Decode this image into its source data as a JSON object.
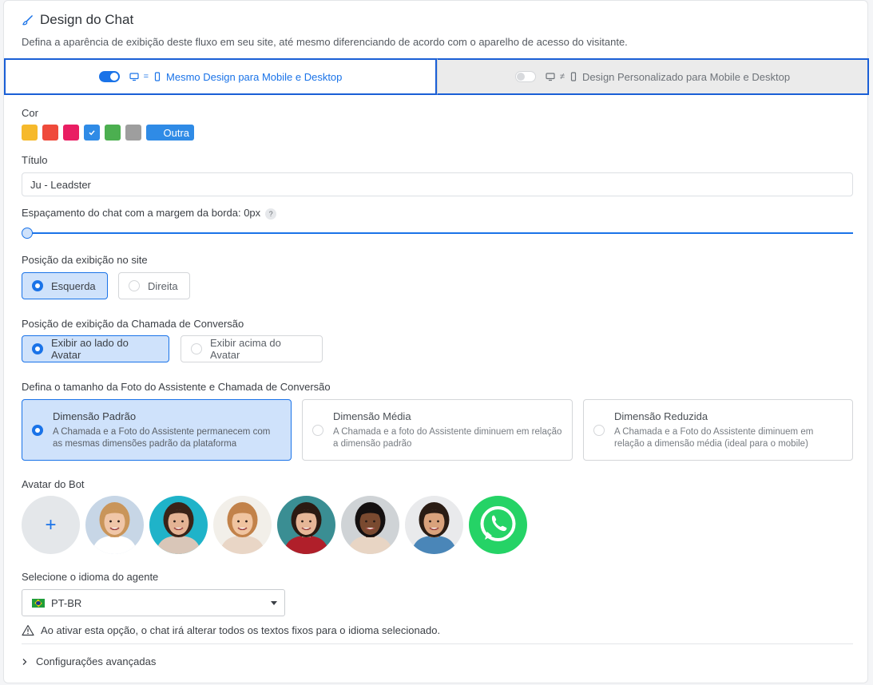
{
  "header": {
    "title": "Design do Chat",
    "subtitle": "Defina a aparência de exibição deste fluxo em seu site, até mesmo diferenciando de acordo com o aparelho de acesso do visitante."
  },
  "tabs": [
    {
      "label": "Mesmo Design para Mobile e Desktop",
      "symbol": "=",
      "active": true
    },
    {
      "label": "Design Personalizado para Mobile e Desktop",
      "symbol": "≠",
      "active": false
    }
  ],
  "color": {
    "label": "Cor",
    "swatches": [
      {
        "hex": "#f6b92b",
        "selected": false
      },
      {
        "hex": "#ef4a3b",
        "selected": false
      },
      {
        "hex": "#e91e63",
        "selected": false
      },
      {
        "hex": "#2f8be6",
        "selected": true
      },
      {
        "hex": "#4caf50",
        "selected": false
      },
      {
        "hex": "#9e9e9e",
        "selected": false
      }
    ],
    "other_label": "Outra",
    "other_hex": "#2f8be6"
  },
  "title_field": {
    "label": "Título",
    "value": "Ju - Leadster"
  },
  "spacing": {
    "label": "Espaçamento do chat com a margem da borda: 0px",
    "help": "?",
    "value": 0
  },
  "position": {
    "label": "Posição da exibição no site",
    "options": [
      {
        "label": "Esquerda",
        "selected": true
      },
      {
        "label": "Direita",
        "selected": false
      }
    ]
  },
  "call_position": {
    "label": "Posição de exibição da Chamada de Conversão",
    "options": [
      {
        "label": "Exibir ao lado do Avatar",
        "selected": true
      },
      {
        "label": "Exibir acima do Avatar",
        "selected": false
      }
    ]
  },
  "size": {
    "label": "Defina o tamanho da Foto do Assistente e Chamada de Conversão",
    "options": [
      {
        "title": "Dimensão Padrão",
        "desc": "A Chamada e a Foto do Assistente permanecem com as mesmas dimensões padrão da plataforma",
        "selected": true
      },
      {
        "title": "Dimensão Média",
        "desc": "A Chamada e a foto do Assistente diminuem em relação a dimensão padrão",
        "selected": false
      },
      {
        "title": "Dimensão Reduzida",
        "desc": "A Chamada e a Foto do Assistente diminuem em relação a dimensão média (ideal para o mobile)",
        "selected": false
      }
    ]
  },
  "avatar": {
    "label": "Avatar do Bot",
    "add": "+",
    "items": [
      {
        "name": "avatar-woman-blonde",
        "bg": "#c7d6e6",
        "skin": "#f0c6a8",
        "hair": "#c9955a",
        "shirt": "#ffffff"
      },
      {
        "name": "avatar-woman-glasses",
        "bg": "#1fb3c9",
        "skin": "#e4b394",
        "hair": "#3a2318",
        "shirt": "#d9c6b8"
      },
      {
        "name": "avatar-woman-redhead",
        "bg": "#f2efe9",
        "skin": "#f0c4a0",
        "hair": "#c2824a",
        "shirt": "#e9d6c6"
      },
      {
        "name": "avatar-woman-brunette",
        "bg": "#3a8e93",
        "skin": "#e6b697",
        "hair": "#2b1a12",
        "shirt": "#b01f2a"
      },
      {
        "name": "avatar-woman-curly",
        "bg": "#cfd3d6",
        "skin": "#7a4a30",
        "hair": "#141010",
        "shirt": "#e8d5c4"
      },
      {
        "name": "avatar-man-beard",
        "bg": "#e9eaec",
        "skin": "#d9a27c",
        "hair": "#2a1c14",
        "shirt": "#4a86b8"
      },
      {
        "name": "avatar-whatsapp",
        "bg": "#25d366",
        "whatsapp": true
      }
    ]
  },
  "language": {
    "label": "Selecione o idioma do agente",
    "value": "PT-BR",
    "warning": "Ao ativar esta opção, o chat irá alterar todos os textos fixos para o idioma selecionado."
  },
  "advanced": {
    "label": "Configurações avançadas"
  }
}
